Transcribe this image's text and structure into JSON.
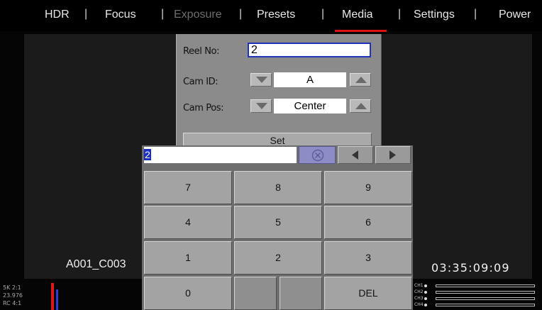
{
  "menu": {
    "items": [
      {
        "label": "HDR",
        "state": "normal"
      },
      {
        "label": "Focus",
        "state": "normal"
      },
      {
        "label": "Exposure",
        "state": "disabled"
      },
      {
        "label": "Presets",
        "state": "normal"
      },
      {
        "label": "Media",
        "state": "selected"
      },
      {
        "label": "Settings",
        "state": "normal"
      },
      {
        "label": "Power",
        "state": "normal"
      }
    ],
    "separator": "|"
  },
  "dialog": {
    "reel_label": "Reel No:",
    "reel_value": "2",
    "cam_id_label": "Cam ID:",
    "cam_id_value": "A",
    "cam_pos_label": "Cam Pos:",
    "cam_pos_value": "Center",
    "set_label": "Set"
  },
  "keypad": {
    "entry_value": "2",
    "keys": {
      "k7": "7",
      "k8": "8",
      "k9": "9",
      "k4": "4",
      "k5": "5",
      "k6": "6",
      "k1": "1",
      "k2": "2",
      "k3": "3",
      "k0": "0",
      "del": "DEL"
    }
  },
  "overlay": {
    "clip_name": "A001_C003",
    "timecode": "03:35:09:09"
  },
  "status": {
    "resolution": "5K 2:1",
    "fps": "23.976",
    "codec": "RC 4:1"
  },
  "audio": {
    "channels": [
      "CH1",
      "CH2",
      "CH3",
      "CH4"
    ]
  },
  "colors": {
    "accent_red": "#d11111",
    "selection_blue": "#1a2fc8",
    "clear_button": "#8e8cc4"
  }
}
